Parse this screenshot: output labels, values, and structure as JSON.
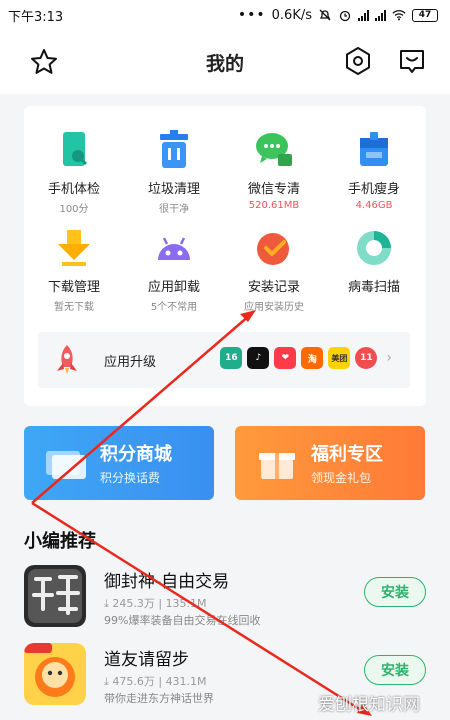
{
  "status_bar": {
    "time": "下午3:13",
    "network_speed": "0.6K/s",
    "battery": "47"
  },
  "header": {
    "title": "我的"
  },
  "tools": [
    {
      "label": "手机体检",
      "sub": "100分",
      "icon": "phone-check-icon"
    },
    {
      "label": "垃圾清理",
      "sub": "很干净",
      "icon": "trash-icon"
    },
    {
      "label": "微信专清",
      "sub": "520.61MB",
      "icon": "wechat-icon"
    },
    {
      "label": "手机瘦身",
      "sub": "4.46GB",
      "icon": "slim-icon"
    },
    {
      "label": "下载管理",
      "sub": "暂无下载",
      "icon": "download-icon"
    },
    {
      "label": "应用卸载",
      "sub": "5个不常用",
      "icon": "android-icon"
    },
    {
      "label": "安装记录",
      "sub": "应用安装历史",
      "icon": "install-record-icon"
    },
    {
      "label": "病毒扫描",
      "sub": "",
      "icon": "virus-scan-icon"
    }
  ],
  "upgrade": {
    "label": "应用升级",
    "apps": [
      "16",
      "",
      "",
      "淘",
      "美团"
    ],
    "count": "11",
    "colors": [
      "#1fae8b",
      "#111111",
      "#ff3b4a",
      "#ff6a00",
      "#ffd100"
    ]
  },
  "promos": [
    {
      "title": "积分商城",
      "sub": "积分换话费"
    },
    {
      "title": "福利专区",
      "sub": "领现金礼包"
    }
  ],
  "recommend": {
    "title": "小编推荐",
    "install_label": "安装",
    "apps": [
      {
        "name": "御封神-自由交易",
        "downloads": "245.3万",
        "size": "135.1M",
        "desc": "99%爆率装备自由交易在线回收",
        "icon": "game-icon-yufengshen"
      },
      {
        "name": "道友请留步",
        "downloads": "475.6万",
        "size": "431.1M",
        "desc": "带你走进东方神话世界",
        "icon": "game-icon-daoyou"
      }
    ]
  },
  "watermark": "爱刨根知识网",
  "colors": {
    "accent_green": "#2db36b",
    "promo_blue": "#3a8ff0",
    "promo_orange": "#ff7a37",
    "annotation_red": "#e8291c"
  }
}
